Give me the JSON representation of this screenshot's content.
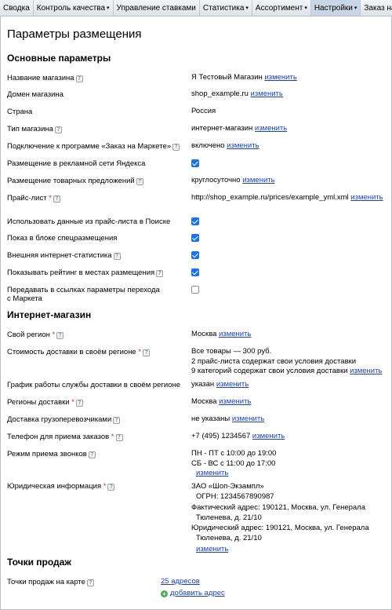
{
  "nav": [
    {
      "label": "Сводка",
      "has_menu": false
    },
    {
      "label": "Контроль качества",
      "has_menu": true
    },
    {
      "label": "Управление ставками",
      "has_menu": false
    },
    {
      "label": "Статистика",
      "has_menu": true
    },
    {
      "label": "Ассортимент",
      "has_menu": true
    },
    {
      "label": "Настройки",
      "has_menu": true,
      "active": true
    },
    {
      "label": "Заказ на Маркете",
      "has_menu": true
    }
  ],
  "nav_arrow": "▾",
  "page_title": "Параметры размещения",
  "help_glyph": "?",
  "required_mark": "*",
  "change_label": "изменить",
  "basic": {
    "title": "Основные параметры",
    "shop_name": {
      "label": "Название магазина",
      "value": "Я Тестовый Магазин"
    },
    "domain": {
      "label": "Домен магазина",
      "value": "shop_example.ru"
    },
    "country": {
      "label": "Страна",
      "value": "Россия"
    },
    "shop_type": {
      "label": "Тип магазина",
      "value": "интернет-магазин"
    },
    "market_order": {
      "label": "Подключение к программе «Заказ на Маркете»",
      "value": "включено"
    },
    "yandex_ads": {
      "label": "Размещение в рекламной сети Яндекса",
      "checked": true
    },
    "offers": {
      "label": "Размещение товарных предложений",
      "value": "круглосуточно"
    },
    "pricelist": {
      "label": "Прайс-лист",
      "value": "http://shop_example.ru/prices/example_yml.xml"
    },
    "use_in_search": {
      "label": "Использовать данные из прайс-листа в Поиске",
      "checked": true
    },
    "special_block": {
      "label": "Показ в блоке спецразмещения",
      "checked": true
    },
    "ext_stats": {
      "label": "Внешняя интернет-статистика",
      "checked": true
    },
    "show_rating": {
      "label": "Показывать рейтинг в местах размещения",
      "checked": true
    },
    "pass_params": {
      "label_line1": "Передавать в ссылках параметры перехода",
      "label_line2": "с Маркета",
      "checked": false
    }
  },
  "shop": {
    "title": "Интернет-магазин",
    "region": {
      "label": "Свой регион",
      "value": "Москва"
    },
    "delivery_cost": {
      "label": "Стоимость доставки в своём регионе",
      "line1": "Все товары — 300 руб.",
      "line2": "2 прайс-листа содержат свои условия доставки",
      "line3": "9 категорий содержат свои условия доставки"
    },
    "delivery_schedule": {
      "label": "График работы службы доставки в своём регионе",
      "value": "указан"
    },
    "delivery_regions": {
      "label": "Регионы доставки",
      "value": "Москва"
    },
    "carriers": {
      "label": "Доставка грузоперевозчиками",
      "value": "не указаны"
    },
    "phone": {
      "label": "Телефон для приема заказов",
      "value": "+7 (495) 1234567"
    },
    "calls": {
      "label": "Режим приема звонков",
      "line1": "ПН - ПТ с 10:00 до 19:00",
      "line2": "СБ - ВС с 11:00 до 17:00"
    },
    "legal": {
      "label": "Юридическая информация",
      "line1": "ЗАО «Шоп-Экзампл»",
      "line2": "ОГРН: 1234567890987",
      "line3": "Фактический адрес: 190121, Москва, ул. Генерала",
      "line4": "Тюленева, д. 21/10",
      "line5": "Юридический адрес: 190121, Москва, ул. Генерала",
      "line6": "Тюленева, д. 21/10"
    }
  },
  "points": {
    "title": "Точки продаж",
    "map": {
      "label": "Точки продаж на карте",
      "count_link": "25 адресов",
      "add_link": "добавить адрес",
      "add_icon": "+"
    }
  }
}
